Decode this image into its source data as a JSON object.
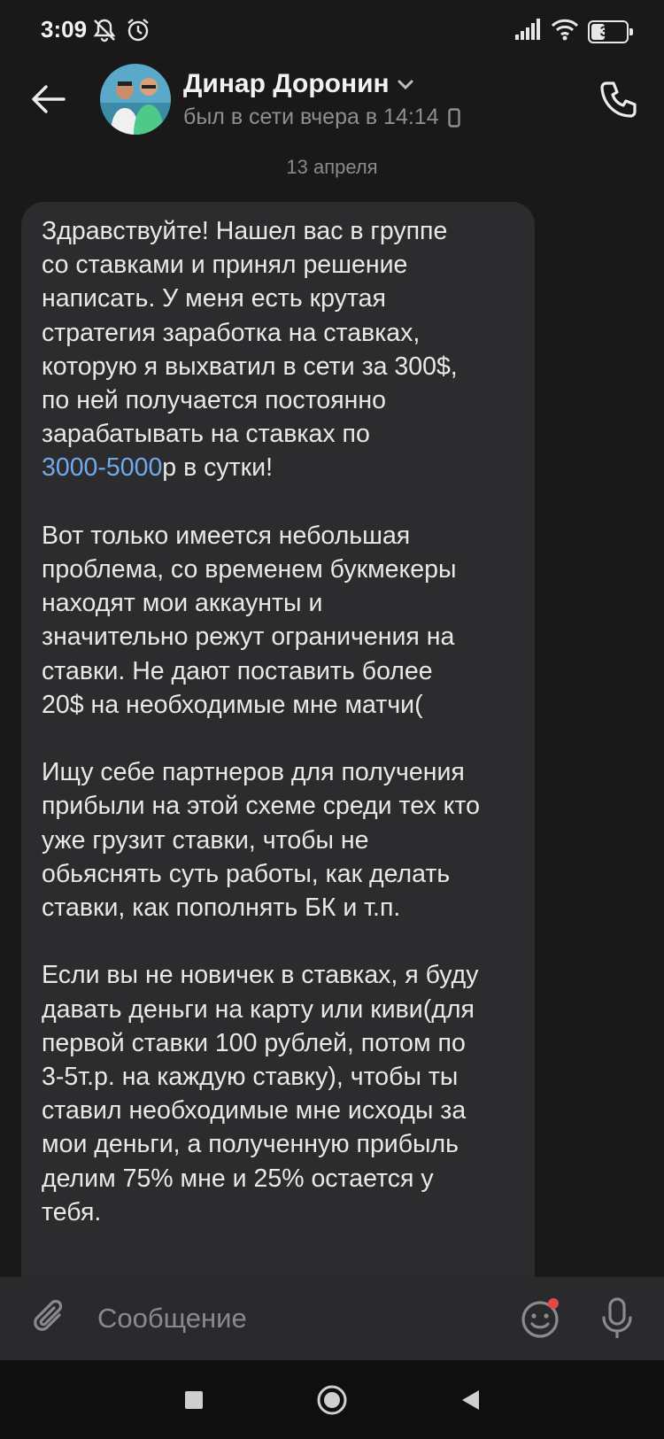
{
  "status_bar": {
    "time": "3:09",
    "battery_level": 39,
    "battery_label": "39",
    "icons": [
      "mute-icon",
      "alarm-icon",
      "signal-icon",
      "wifi-icon",
      "battery-icon"
    ]
  },
  "header": {
    "contact_name": "Динар Доронин",
    "last_seen": "был в сети вчера в 14:14",
    "icons": [
      "back-arrow-icon",
      "chevron-down-icon",
      "mobile-device-icon",
      "phone-icon"
    ]
  },
  "chat": {
    "date_separator": "13 апреля",
    "message": {
      "paragraphs": [
        {
          "lines": [
            "Здравствуйте! Нашел вас в группе",
            "со ставками и принял решение",
            "написать. У меня есть крутая",
            "стратегия заработка на ставках,",
            "которую я выхватил в сети за 300$,",
            "по ней получается постоянно",
            "зарабатывать на ставках по"
          ],
          "link_line": {
            "link": "3000-5000",
            "rest": "р в сутки!"
          }
        },
        {
          "lines": [
            "Вот только имеется небольшая",
            "проблема, со временем букмекеры",
            "находят мои аккаунты и",
            "значительно режут ограничения на",
            "ставки. Не дают поставить более",
            "20$ на необходимые мне матчи("
          ]
        },
        {
          "lines": [
            "Ищу себе партнеров для получения",
            "прибыли на этой схеме среди тех кто",
            "уже грузит ставки, чтобы не",
            "обьяснять суть работы, как делать",
            "ставки, как пополнять БК и т.п."
          ]
        },
        {
          "lines": [
            "Если вы не новичек в ставках, я буду",
            "давать деньги на карту или киви(для",
            "первой ставки 100 рублей, потом по",
            "3-5т.р. на каждую ставку), чтобы ты",
            "ставил необходимые мне исходы за",
            "мои деньги, а полученную прибыль",
            "делим 75% мне и 25% остается у",
            "тебя."
          ]
        }
      ]
    }
  },
  "composer": {
    "placeholder": "Сообщение",
    "value": "",
    "icons": [
      "paperclip-icon",
      "emoji-icon",
      "microphone-icon"
    ]
  },
  "nav_bar": {
    "icons": [
      "recents-square-icon",
      "home-circle-icon",
      "back-triangle-icon"
    ]
  },
  "colors": {
    "background": "#19191a",
    "bubble": "#2c2c2e",
    "link": "#71aaeb",
    "secondary_text": "#8e8e93",
    "notification_dot": "#e64646"
  }
}
